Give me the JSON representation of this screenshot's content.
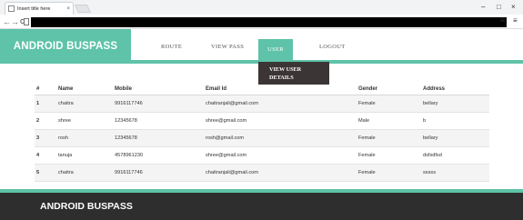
{
  "browser": {
    "tab_title": "Insert title here",
    "tab_close": "×",
    "back": "←",
    "forward": "→",
    "reload": "C",
    "minimize": "–",
    "maximize": "□",
    "close": "×",
    "star": "☆",
    "menu": "≡"
  },
  "header": {
    "brand": "ANDROID BUSPASS",
    "nav": [
      "ROUTE",
      "VIEW PASS",
      "USER",
      "LOGOUT"
    ],
    "active_nav": "USER",
    "dropdown_items": [
      "VIEW USER DETAILS"
    ],
    "accent_color": "#5ec3a8"
  },
  "table": {
    "columns": [
      "#",
      "Name",
      "Mobile",
      "Email Id",
      "Gender",
      "Address"
    ],
    "rows": [
      [
        "1",
        "chaitra",
        "9916117746",
        "chaitranjali@gmail.com",
        "Female",
        "bellary"
      ],
      [
        "2",
        "shree",
        "12345678",
        "shree@gmail.com",
        "Male",
        "b"
      ],
      [
        "3",
        "rosh",
        "12345678",
        "rosh@gmail.com",
        "Female",
        "bellary"
      ],
      [
        "4",
        "tanuja",
        "4578961230",
        "shree@gmail.com",
        "Female",
        "dsfsdfsd"
      ],
      [
        "5",
        "chaitra",
        "9916117746",
        "chaitranjali@gmail.com",
        "Female",
        "sssss"
      ]
    ]
  },
  "footer": {
    "brand": "ANDROID BUSPASS"
  }
}
